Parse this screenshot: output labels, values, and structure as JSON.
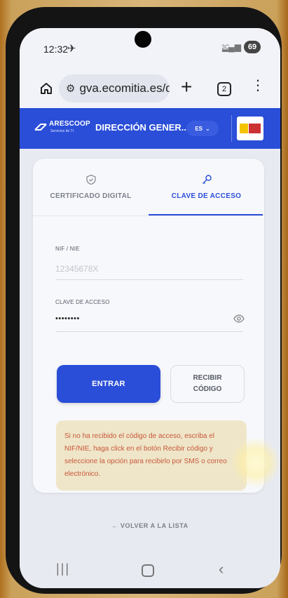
{
  "status_bar": {
    "time": "12:32",
    "network": "3G",
    "battery": "69"
  },
  "browser": {
    "url": "gva.ecomitia.es/dgd",
    "tab_count": "2"
  },
  "header": {
    "logo_name": "ARESCOOP",
    "logo_sub": "Servicios de TI",
    "title": "DIRECCIÓN GENER...",
    "language": "ES"
  },
  "tabs": [
    {
      "label": "CERTIFICADO DIGITAL",
      "icon": "shield-icon"
    },
    {
      "label": "CLAVE DE ACCESO",
      "icon": "key-icon",
      "active": true
    }
  ],
  "form": {
    "nif_label": "NIF / NIE",
    "nif_placeholder": "12345678X",
    "password_label": "CLAVE DE ACCESO",
    "password_value": "••••••••"
  },
  "buttons": {
    "enter": "ENTRAR",
    "receive_code": "RECIBIR CÓDIGO"
  },
  "notice": "Si no ha recibido el código de acceso, escriba el NIF/NIE, haga click en el botón Recibir código y seleccione la opción para recibirlo por SMS o correo electrónico.",
  "back_link": "← VOLVER A LA LISTA",
  "colors": {
    "brand_blue": "#2a4ed8",
    "notice_bg": "#efe6c9",
    "notice_text": "#c8573a"
  }
}
